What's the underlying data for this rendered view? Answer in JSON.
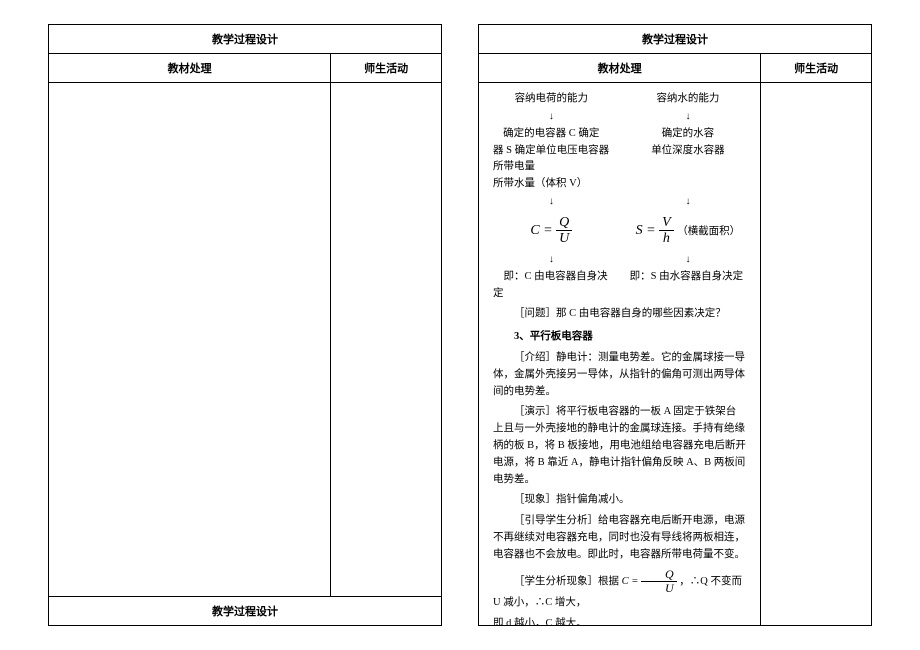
{
  "headers": {
    "main": "教学过程设计",
    "left": "教材处理",
    "right": "师生活动"
  },
  "page2": {
    "row1_left": "容纳电荷的能力",
    "row1_right": "容纳水的能力",
    "row2_left_a": "确定的电容器 C 确定",
    "row2_left_b": "器 S 确定单位电压电容器所带电量",
    "row2_left_c": "所带水量（体积 V）",
    "row2_right_a": "确定的水容",
    "row2_right_b": "单位深度水容器",
    "formula_left_lhs": "C =",
    "formula_left_top": "Q",
    "formula_left_bot": "U",
    "formula_right_lhs": "S =",
    "formula_right_top": "V",
    "formula_right_bot": "h",
    "formula_right_note": "（横截面积）",
    "row3_left": "即：C 由电容器自身决定",
    "row3_right": "即：S 由水容器自身决定",
    "question": "［问题］那 C 由电容器自身的哪些因素决定？",
    "sec3_title": "3、平行板电容器",
    "p_intro": "［介绍］静电计：测量电势差。它的金属球接一导体，金属外壳接另一导体，从指针的偏角可测出两导体间的电势差。",
    "p_demo": "［演示］将平行板电容器的一板 A 固定于铁架台上且与一外壳接地的静电计的金属球连接。手持有绝缘柄的板 B，将 B 板接地，用电池组给电容器充电后断开电源，将 B 靠近 A，静电计指针偏角反映 A、B 两板间电势差。",
    "p_phen": "［现象］指针偏角减小。",
    "p_lead": "［引导学生分析］给电容器充电后断开电源，电源不再继续对电容器充电，同时也没有导线将两板相连，电容器也不会放电。即此时，电容器所带电荷量不变。",
    "p_analysis_a": "［学生分析现象］根据",
    "p_analysis_lhs": "C =",
    "p_analysis_top": "Q",
    "p_analysis_bot": "U",
    "p_analysis_b": "，∴Q 不变而 U 减小，∴C 增大，",
    "p_analysis_c": "即 d 越小，C 越大。"
  }
}
